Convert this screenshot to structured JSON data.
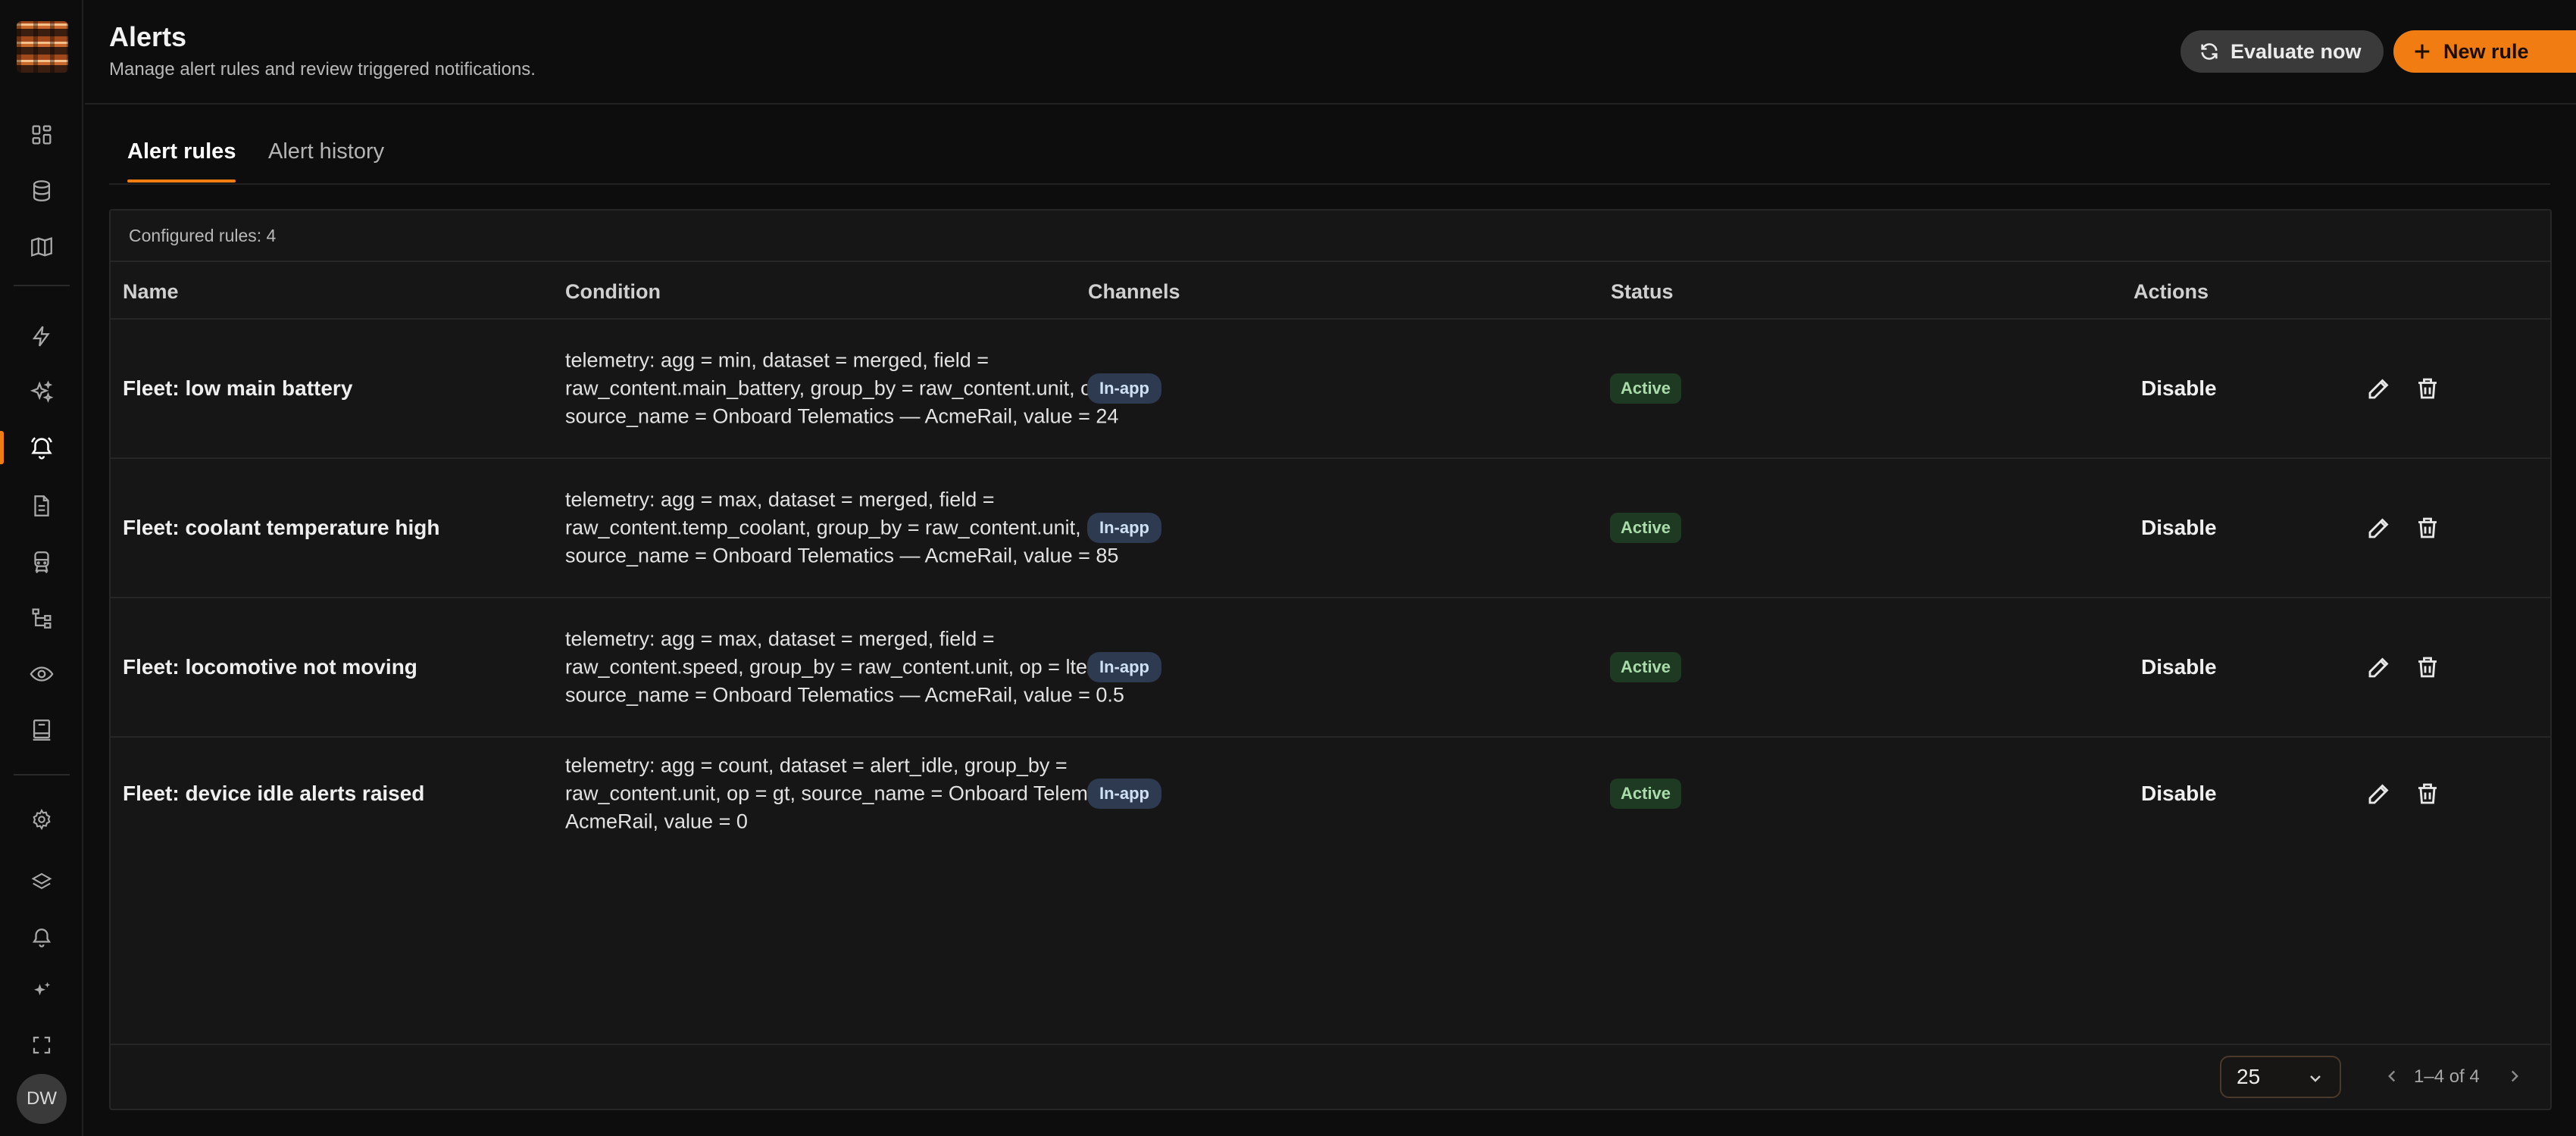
{
  "header": {
    "title": "Alerts",
    "subtitle": "Manage alert rules and review triggered notifications.",
    "evaluate_label": "Evaluate now",
    "new_rule_label": "New rule"
  },
  "sidebar": {
    "items": [
      {
        "icon": "dashboard-icon"
      },
      {
        "icon": "database-icon"
      },
      {
        "icon": "map-icon"
      },
      {
        "icon": "lightning-icon"
      },
      {
        "icon": "sparkles-icon"
      },
      {
        "icon": "bell-alert-icon",
        "active": true
      },
      {
        "icon": "document-icon"
      },
      {
        "icon": "train-icon"
      },
      {
        "icon": "hierarchy-icon"
      },
      {
        "icon": "eye-icon"
      },
      {
        "icon": "report-icon"
      }
    ],
    "bottom_items": [
      {
        "icon": "settings-icon"
      },
      {
        "icon": "layers-icon"
      },
      {
        "icon": "bell-icon"
      },
      {
        "icon": "sparkle-icon"
      },
      {
        "icon": "fullscreen-icon"
      }
    ],
    "avatar_initials": "DW"
  },
  "tabs": [
    {
      "label": "Alert rules",
      "active": true
    },
    {
      "label": "Alert history",
      "active": false
    }
  ],
  "table": {
    "summary": "Configured rules: 4",
    "columns": [
      "Name",
      "Condition",
      "Channels",
      "Status",
      "Actions"
    ],
    "rows": [
      {
        "name": "Fleet: low main battery",
        "condition": "telemetry: agg = min, dataset = merged, field = raw_content.main_battery, group_by = raw_content.unit, op = lt, source_name = Onboard Telematics — AcmeRail, value = 24",
        "channel": "In-app",
        "status": "Active",
        "action": "Disable"
      },
      {
        "name": "Fleet: coolant temperature high",
        "condition": "telemetry: agg = max, dataset = merged, field = raw_content.temp_coolant, group_by = raw_content.unit, op = gt, source_name = Onboard Telematics — AcmeRail, value = 85",
        "channel": "In-app",
        "status": "Active",
        "action": "Disable"
      },
      {
        "name": "Fleet: locomotive not moving",
        "condition": "telemetry: agg = max, dataset = merged, field = raw_content.speed, group_by = raw_content.unit, op = lte, source_name = Onboard Telematics — AcmeRail, value = 0.5",
        "channel": "In-app",
        "status": "Active",
        "action": "Disable"
      },
      {
        "name": "Fleet: device idle alerts raised",
        "condition": "telemetry: agg = count, dataset = alert_idle, group_by = raw_content.unit, op = gt, source_name = Onboard Telematics — AcmeRail, value = 0",
        "channel": "In-app",
        "status": "Active",
        "action": "Disable"
      }
    ]
  },
  "pagination": {
    "per_page": "25",
    "range": "1–4 of 4"
  },
  "colors": {
    "accent": "#f07c12",
    "background": "#0d0d0d",
    "panel": "#161616",
    "status_active_bg": "#1f3a22",
    "channel_chip_bg": "#2e3a4f"
  }
}
